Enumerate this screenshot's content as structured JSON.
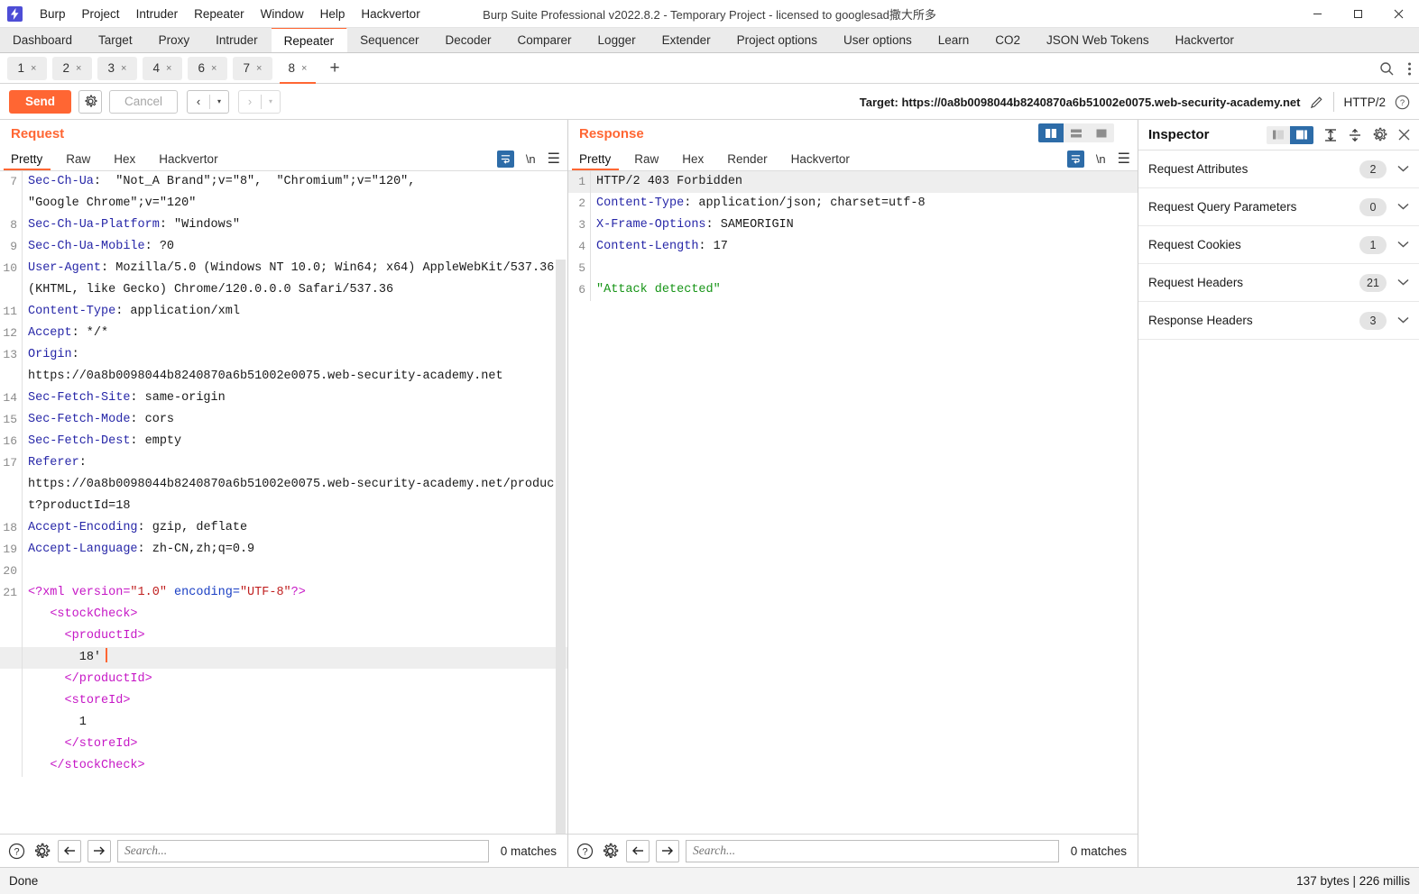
{
  "window": {
    "title": "Burp Suite Professional v2022.8.2 - Temporary Project - licensed to googlesad撒大所多",
    "minimize": "─",
    "maximize": "☐",
    "close": "✕",
    "logo_glyph": "⚡"
  },
  "menubar": {
    "items": [
      "Burp",
      "Project",
      "Intruder",
      "Repeater",
      "Window",
      "Help",
      "Hackvertor"
    ]
  },
  "main_tabs": {
    "items": [
      "Dashboard",
      "Target",
      "Proxy",
      "Intruder",
      "Repeater",
      "Sequencer",
      "Decoder",
      "Comparer",
      "Logger",
      "Extender",
      "Project options",
      "User options",
      "Learn",
      "CO2",
      "JSON Web Tokens",
      "Hackvertor"
    ],
    "active": "Repeater"
  },
  "repeater_tabs": {
    "items": [
      {
        "label": "1",
        "close": "×"
      },
      {
        "label": "2",
        "close": "×"
      },
      {
        "label": "3",
        "close": "×"
      },
      {
        "label": "4",
        "close": "×"
      },
      {
        "label": "6",
        "close": "×"
      },
      {
        "label": "7",
        "close": "×"
      },
      {
        "label": "8",
        "close": "×"
      }
    ],
    "active_index": 6,
    "add_label": "+"
  },
  "toolbar": {
    "send_label": "Send",
    "cancel_label": "Cancel",
    "back_glyph": "‹",
    "forward_glyph": "›",
    "caret_glyph": "▾",
    "target_label": "Target: https://0a8b0098044b8240870a6b51002e0075.web-security-academy.net",
    "http_version": "HTTP/2"
  },
  "request": {
    "title": "Request",
    "tabs": [
      "Pretty",
      "Raw",
      "Hex",
      "Hackvertor"
    ],
    "active_tab": "Pretty",
    "newline_label": "\\n",
    "lines": [
      {
        "n": "7",
        "segments": [
          {
            "t": "Sec-Ch-Ua",
            "c": "hdr"
          },
          {
            "t": ":  \"Not_A Brand\";v=\"8\",  \"Chromium\";v=\"120\",",
            "c": "val"
          }
        ]
      },
      {
        "n": "",
        "segments": [
          {
            "t": "\"Google Chrome\";v=\"120\"",
            "c": "val"
          }
        ]
      },
      {
        "n": "8",
        "segments": [
          {
            "t": "Sec-Ch-Ua-Platform",
            "c": "hdr"
          },
          {
            "t": ": \"Windows\"",
            "c": "val"
          }
        ]
      },
      {
        "n": "9",
        "segments": [
          {
            "t": "Sec-Ch-Ua-Mobile",
            "c": "hdr"
          },
          {
            "t": ": ?0",
            "c": "val"
          }
        ]
      },
      {
        "n": "10",
        "segments": [
          {
            "t": "User-Agent",
            "c": "hdr"
          },
          {
            "t": ": Mozilla/5.0 (Windows NT 10.0; Win64; x64) AppleWebKit/537.36 (KHTML, like Gecko) Chrome/120.0.0.0 Safari/537.36",
            "c": "val"
          }
        ]
      },
      {
        "n": "11",
        "segments": [
          {
            "t": "Content-Type",
            "c": "hdr"
          },
          {
            "t": ": application/xml",
            "c": "val"
          }
        ]
      },
      {
        "n": "12",
        "segments": [
          {
            "t": "Accept",
            "c": "hdr"
          },
          {
            "t": ": */*",
            "c": "val"
          }
        ]
      },
      {
        "n": "13",
        "segments": [
          {
            "t": "Origin",
            "c": "hdr"
          },
          {
            "t": ":\nhttps://0a8b0098044b8240870a6b51002e0075.web-security-academy.net",
            "c": "val"
          }
        ]
      },
      {
        "n": "14",
        "segments": [
          {
            "t": "Sec-Fetch-Site",
            "c": "hdr"
          },
          {
            "t": ": same-origin",
            "c": "val"
          }
        ]
      },
      {
        "n": "15",
        "segments": [
          {
            "t": "Sec-Fetch-Mode",
            "c": "hdr"
          },
          {
            "t": ": cors",
            "c": "val"
          }
        ]
      },
      {
        "n": "16",
        "segments": [
          {
            "t": "Sec-Fetch-Dest",
            "c": "hdr"
          },
          {
            "t": ": empty",
            "c": "val"
          }
        ]
      },
      {
        "n": "17",
        "segments": [
          {
            "t": "Referer",
            "c": "hdr"
          },
          {
            "t": ":\nhttps://0a8b0098044b8240870a6b51002e0075.web-security-academy.net/product?productId=18",
            "c": "val"
          }
        ]
      },
      {
        "n": "18",
        "segments": [
          {
            "t": "Accept-Encoding",
            "c": "hdr"
          },
          {
            "t": ": gzip, deflate",
            "c": "val"
          }
        ]
      },
      {
        "n": "19",
        "segments": [
          {
            "t": "Accept-Language",
            "c": "hdr"
          },
          {
            "t": ": zh-CN,zh;q=0.9",
            "c": "val"
          }
        ]
      },
      {
        "n": "20",
        "segments": [
          {
            "t": "",
            "c": "val"
          }
        ]
      },
      {
        "n": "21",
        "segments": [
          {
            "t": "<?xml version=",
            "c": "tag"
          },
          {
            "t": "\"1.0\"",
            "c": "str"
          },
          {
            "t": " encoding=",
            "c": "attr"
          },
          {
            "t": "\"UTF-8\"",
            "c": "str"
          },
          {
            "t": "?>",
            "c": "tag"
          }
        ]
      },
      {
        "n": "",
        "segments": [
          {
            "t": "   <stockCheck>",
            "c": "tag"
          }
        ]
      },
      {
        "n": "",
        "segments": [
          {
            "t": "     <productId>",
            "c": "tag"
          }
        ]
      },
      {
        "n": "",
        "segments": [
          {
            "t": "       18'",
            "c": "val"
          }
        ],
        "highlight": true,
        "caret": true
      },
      {
        "n": "",
        "segments": [
          {
            "t": "     </productId>",
            "c": "tag"
          }
        ]
      },
      {
        "n": "",
        "segments": [
          {
            "t": "     <storeId>",
            "c": "tag"
          }
        ]
      },
      {
        "n": "",
        "segments": [
          {
            "t": "       1",
            "c": "val"
          }
        ]
      },
      {
        "n": "",
        "segments": [
          {
            "t": "     </storeId>",
            "c": "tag"
          }
        ]
      },
      {
        "n": "",
        "segments": [
          {
            "t": "   </stockCheck>",
            "c": "tag"
          }
        ]
      }
    ],
    "search_placeholder": "Search...",
    "matches": "0 matches"
  },
  "response": {
    "title": "Response",
    "tabs": [
      "Pretty",
      "Raw",
      "Hex",
      "Render",
      "Hackvertor"
    ],
    "active_tab": "Pretty",
    "newline_label": "\\n",
    "lines": [
      {
        "n": "1",
        "segments": [
          {
            "t": "HTTP/2 403 Forbidden",
            "c": "val"
          }
        ],
        "highlight": true
      },
      {
        "n": "2",
        "segments": [
          {
            "t": "Content-Type",
            "c": "hdr"
          },
          {
            "t": ": application/json; charset=utf-8",
            "c": "val"
          }
        ]
      },
      {
        "n": "3",
        "segments": [
          {
            "t": "X-Frame-Options",
            "c": "hdr"
          },
          {
            "t": ": SAMEORIGIN",
            "c": "val"
          }
        ]
      },
      {
        "n": "4",
        "segments": [
          {
            "t": "Content-Length",
            "c": "hdr"
          },
          {
            "t": ": 17",
            "c": "val"
          }
        ]
      },
      {
        "n": "5",
        "segments": [
          {
            "t": "",
            "c": "val"
          }
        ]
      },
      {
        "n": "6",
        "segments": [
          {
            "t": "\"Attack detected\"",
            "c": "green"
          }
        ]
      }
    ],
    "search_placeholder": "Search...",
    "matches": "0 matches",
    "layout_modes": [
      "side-by-side",
      "stacked",
      "single"
    ],
    "active_layout": "side-by-side"
  },
  "inspector": {
    "title": "Inspector",
    "close_glyph": "✕",
    "rows": [
      {
        "label": "Request Attributes",
        "count": "2"
      },
      {
        "label": "Request Query Parameters",
        "count": "0"
      },
      {
        "label": "Request Cookies",
        "count": "1"
      },
      {
        "label": "Request Headers",
        "count": "21"
      },
      {
        "label": "Response Headers",
        "count": "3"
      }
    ],
    "chevron": "⌄"
  },
  "statusbar": {
    "left": "Done",
    "right": "137 bytes | 226 millis"
  },
  "colors": {
    "accent_orange": "#ff6633",
    "accent_blue": "#2d6ca8",
    "header_blue": "#2727a8",
    "tag_magenta": "#c617c6",
    "string_red": "#c02020",
    "green": "#169416",
    "teal_edge": "#19c39c"
  }
}
